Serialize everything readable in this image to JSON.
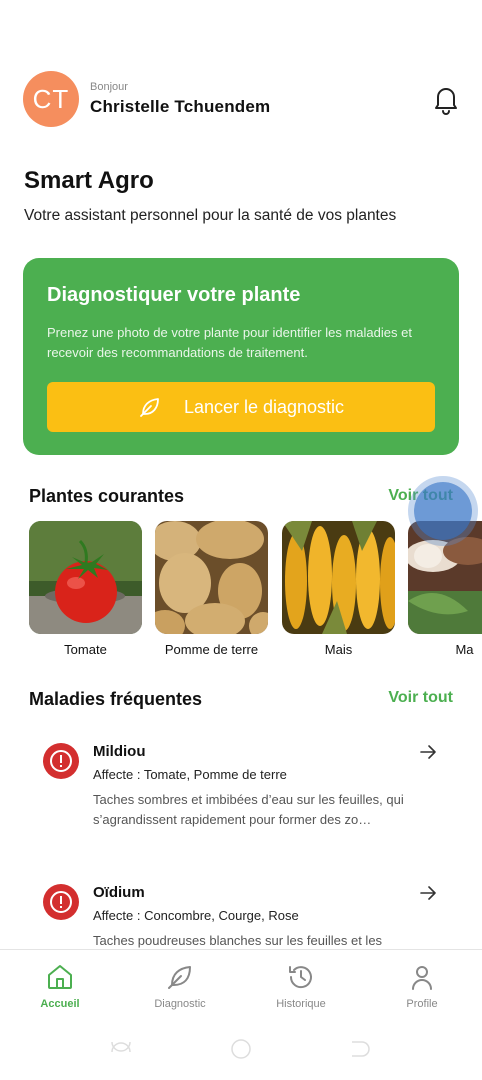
{
  "header": {
    "avatar_initials": "CT",
    "greeting": "Bonjour",
    "user_name": "Christelle Tchuendem"
  },
  "app": {
    "title": "Smart Agro",
    "subtitle": "Votre assistant personnel pour la santé de vos plantes"
  },
  "diagnose_card": {
    "title": "Diagnostiquer votre plante",
    "description": "Prenez une photo de votre plante pour identifier les maladies et recevoir des recommandations de traitement.",
    "button_label": "Lancer le diagnostic"
  },
  "plants": {
    "section_title": "Plantes courantes",
    "see_all": "Voir tout",
    "items": [
      {
        "label": "Tomate"
      },
      {
        "label": "Pomme de terre"
      },
      {
        "label": "Mais"
      },
      {
        "label": "Ma"
      }
    ]
  },
  "diseases": {
    "section_title": "Maladies fréquentes",
    "see_all": "Voir tout",
    "items": [
      {
        "name": "Mildiou",
        "affects": "Affecte : Tomate, Pomme de terre",
        "description": "Taches sombres et imbibées d’eau sur les feuilles, qui s’agrandissent rapidement pour former des zo…"
      },
      {
        "name": "Oïdium",
        "affects": "Affecte : Concombre, Courge, Rose",
        "description": "Taches poudreuses blanches sur les feuilles et les"
      }
    ]
  },
  "nav": {
    "items": [
      {
        "label": "Accueil",
        "icon": "home-icon",
        "active": true
      },
      {
        "label": "Diagnostic",
        "icon": "leaf-icon",
        "active": false
      },
      {
        "label": "Historique",
        "icon": "history-icon",
        "active": false
      },
      {
        "label": "Profile",
        "icon": "user-icon",
        "active": false
      }
    ]
  },
  "colors": {
    "primary_green": "#4CAF50",
    "button_yellow": "#FBBF13",
    "avatar_orange": "#F58E5E",
    "alert_red": "#D32F2F"
  }
}
